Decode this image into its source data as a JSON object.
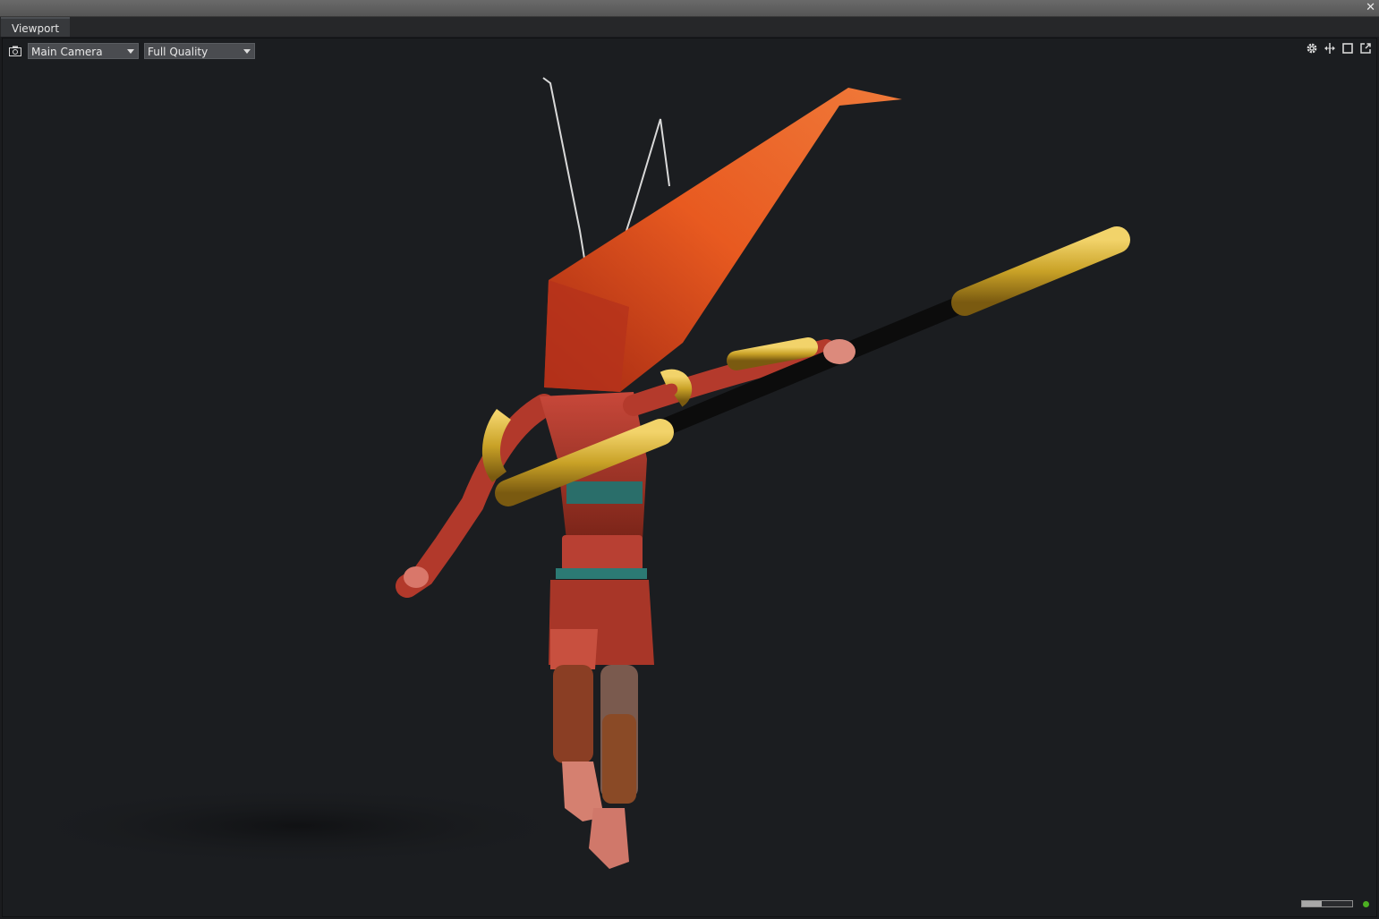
{
  "window": {
    "close_glyph": "✕"
  },
  "tabs": [
    {
      "label": "Viewport"
    }
  ],
  "toolbar": {
    "camera_icon": "camera-icon",
    "camera_select": {
      "value": "Main Camera"
    },
    "quality_select": {
      "value": "Full Quality"
    },
    "right_icons": [
      "gear-icon",
      "pan-arrows-icon",
      "maximize-square-icon",
      "popout-icon"
    ]
  },
  "status": {
    "progress": 0.4,
    "indicator_color": "#4caf22"
  },
  "scene": {
    "description_colors": {
      "background": "#1b1d20",
      "banner": "#e0481c",
      "gold": "#c9a227",
      "staff": "#0c0c0c"
    }
  }
}
